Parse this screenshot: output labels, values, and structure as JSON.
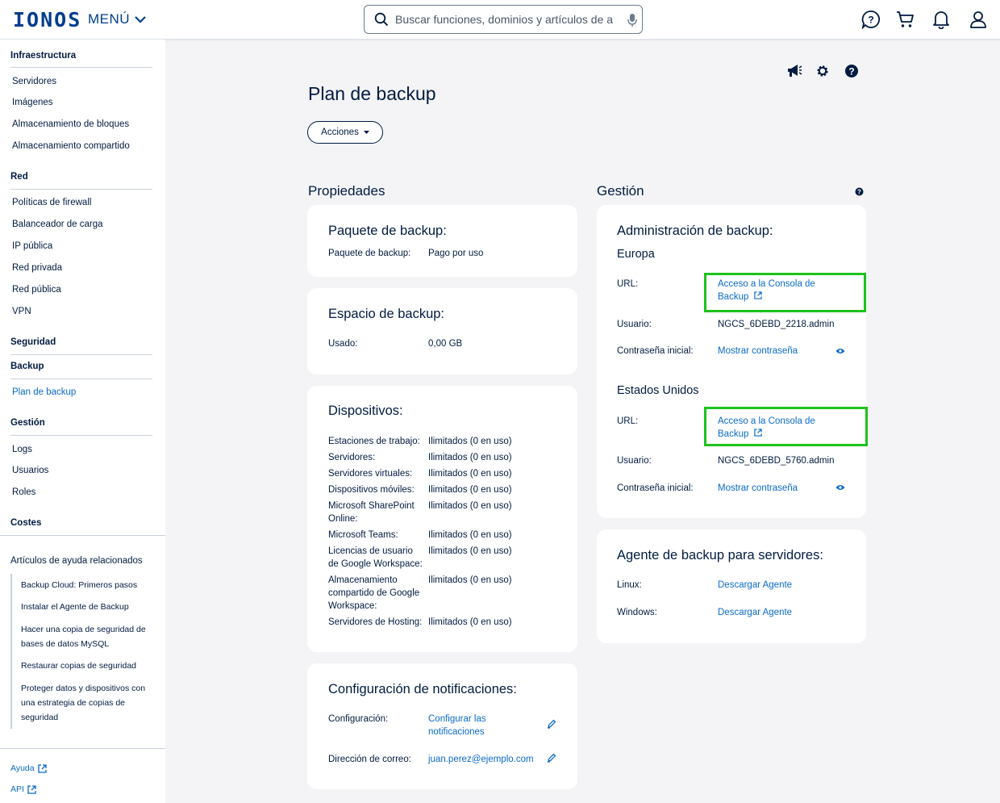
{
  "header": {
    "logo": "IONOS",
    "menu_label": "MENÚ",
    "search_placeholder": "Buscar funciones, dominios y artículos de ay..."
  },
  "sidebar": {
    "sections": [
      {
        "title": "Infraestructura",
        "items": [
          "Servidores",
          "Imágenes",
          "Almacenamiento de bloques",
          "Almacenamiento compartido"
        ]
      },
      {
        "title": "Red",
        "items": [
          "Políticas de firewall",
          "Balanceador de carga",
          "IP pública",
          "Red privada",
          "Red pública",
          "VPN"
        ]
      },
      {
        "title": "Seguridad"
      },
      {
        "title": "Backup",
        "items": [
          "Plan de backup"
        ]
      },
      {
        "title": "Gestión",
        "items": [
          "Logs",
          "Usuarios",
          "Roles"
        ]
      },
      {
        "title": "Costes"
      }
    ],
    "related_title": "Artículos de ayuda relacionados",
    "related": [
      "Backup Cloud: Primeros pasos",
      "Instalar el Agente de Backup",
      "Hacer una copia de seguridad de bases de datos MySQL",
      "Restaurar copias de seguridad",
      "Proteger datos y dispositivos con una estrategia de copias de seguridad"
    ],
    "footer_links": [
      "Ayuda",
      "API"
    ]
  },
  "page": {
    "title": "Plan de backup",
    "actions_label": "Acciones"
  },
  "properties": {
    "title": "Propiedades",
    "package": {
      "title": "Paquete de backup:",
      "label": "Paquete de backup:",
      "value": "Pago por uso"
    },
    "space": {
      "title": "Espacio de backup:",
      "label": "Usado:",
      "value": "0,00 GB"
    },
    "devices": {
      "title": "Dispositivos:",
      "rows": [
        {
          "label": "Estaciones de trabajo:",
          "value": "Ilimitados (0 en uso)"
        },
        {
          "label": "Servidores:",
          "value": "Ilimitados (0 en uso)"
        },
        {
          "label": "Servidores virtuales:",
          "value": "Ilimitados (0 en uso)"
        },
        {
          "label": "Dispositivos móviles:",
          "value": "Ilimitados (0 en uso)"
        },
        {
          "label": "Microsoft SharePoint Online:",
          "value": "Ilimitados (0 en uso)"
        },
        {
          "label": "Microsoft Teams:",
          "value": "Ilimitados (0 en uso)"
        },
        {
          "label": "Licencias de usuario de Google Workspace:",
          "value": "Ilimitados (0 en uso)"
        },
        {
          "label": "Almacenamiento compartido de Google Workspace:",
          "value": "Ilimitados (0 en uso)"
        },
        {
          "label": "Servidores de Hosting:",
          "value": "Ilimitados (0 en uso)"
        }
      ]
    },
    "notifications": {
      "title": "Configuración de notificaciones:",
      "config_label": "Configuración:",
      "config_link": "Configurar las notificaciones",
      "email_label": "Dirección de correo:",
      "email_value": "juan.perez@ejemplo.com"
    }
  },
  "management": {
    "title": "Gestión",
    "admin": {
      "title": "Administración de backup:",
      "regions": [
        {
          "name": "Europa",
          "url_label": "URL:",
          "url_link": "Acceso a la Consola de Backup",
          "user_label": "Usuario:",
          "user_value": "NGCS_6DEBD_2218.admin",
          "pass_label": "Contraseña inicial:",
          "pass_link": "Mostrar contraseña"
        },
        {
          "name": "Estados Unidos",
          "url_label": "URL:",
          "url_link": "Acceso a la Consola de Backup",
          "user_label": "Usuario:",
          "user_value": "NGCS_6DEBD_5760.admin",
          "pass_label": "Contraseña inicial:",
          "pass_link": "Mostrar contraseña"
        }
      ]
    },
    "agent": {
      "title": "Agente de backup para servidores:",
      "rows": [
        {
          "label": "Linux:",
          "link": "Descargar Agente"
        },
        {
          "label": "Windows:",
          "link": "Descargar Agente"
        }
      ]
    }
  },
  "colors": {
    "brand": "#003d8f",
    "link": "#0b6ac7",
    "highlight": "#1dc21d",
    "text": "#001b41"
  }
}
